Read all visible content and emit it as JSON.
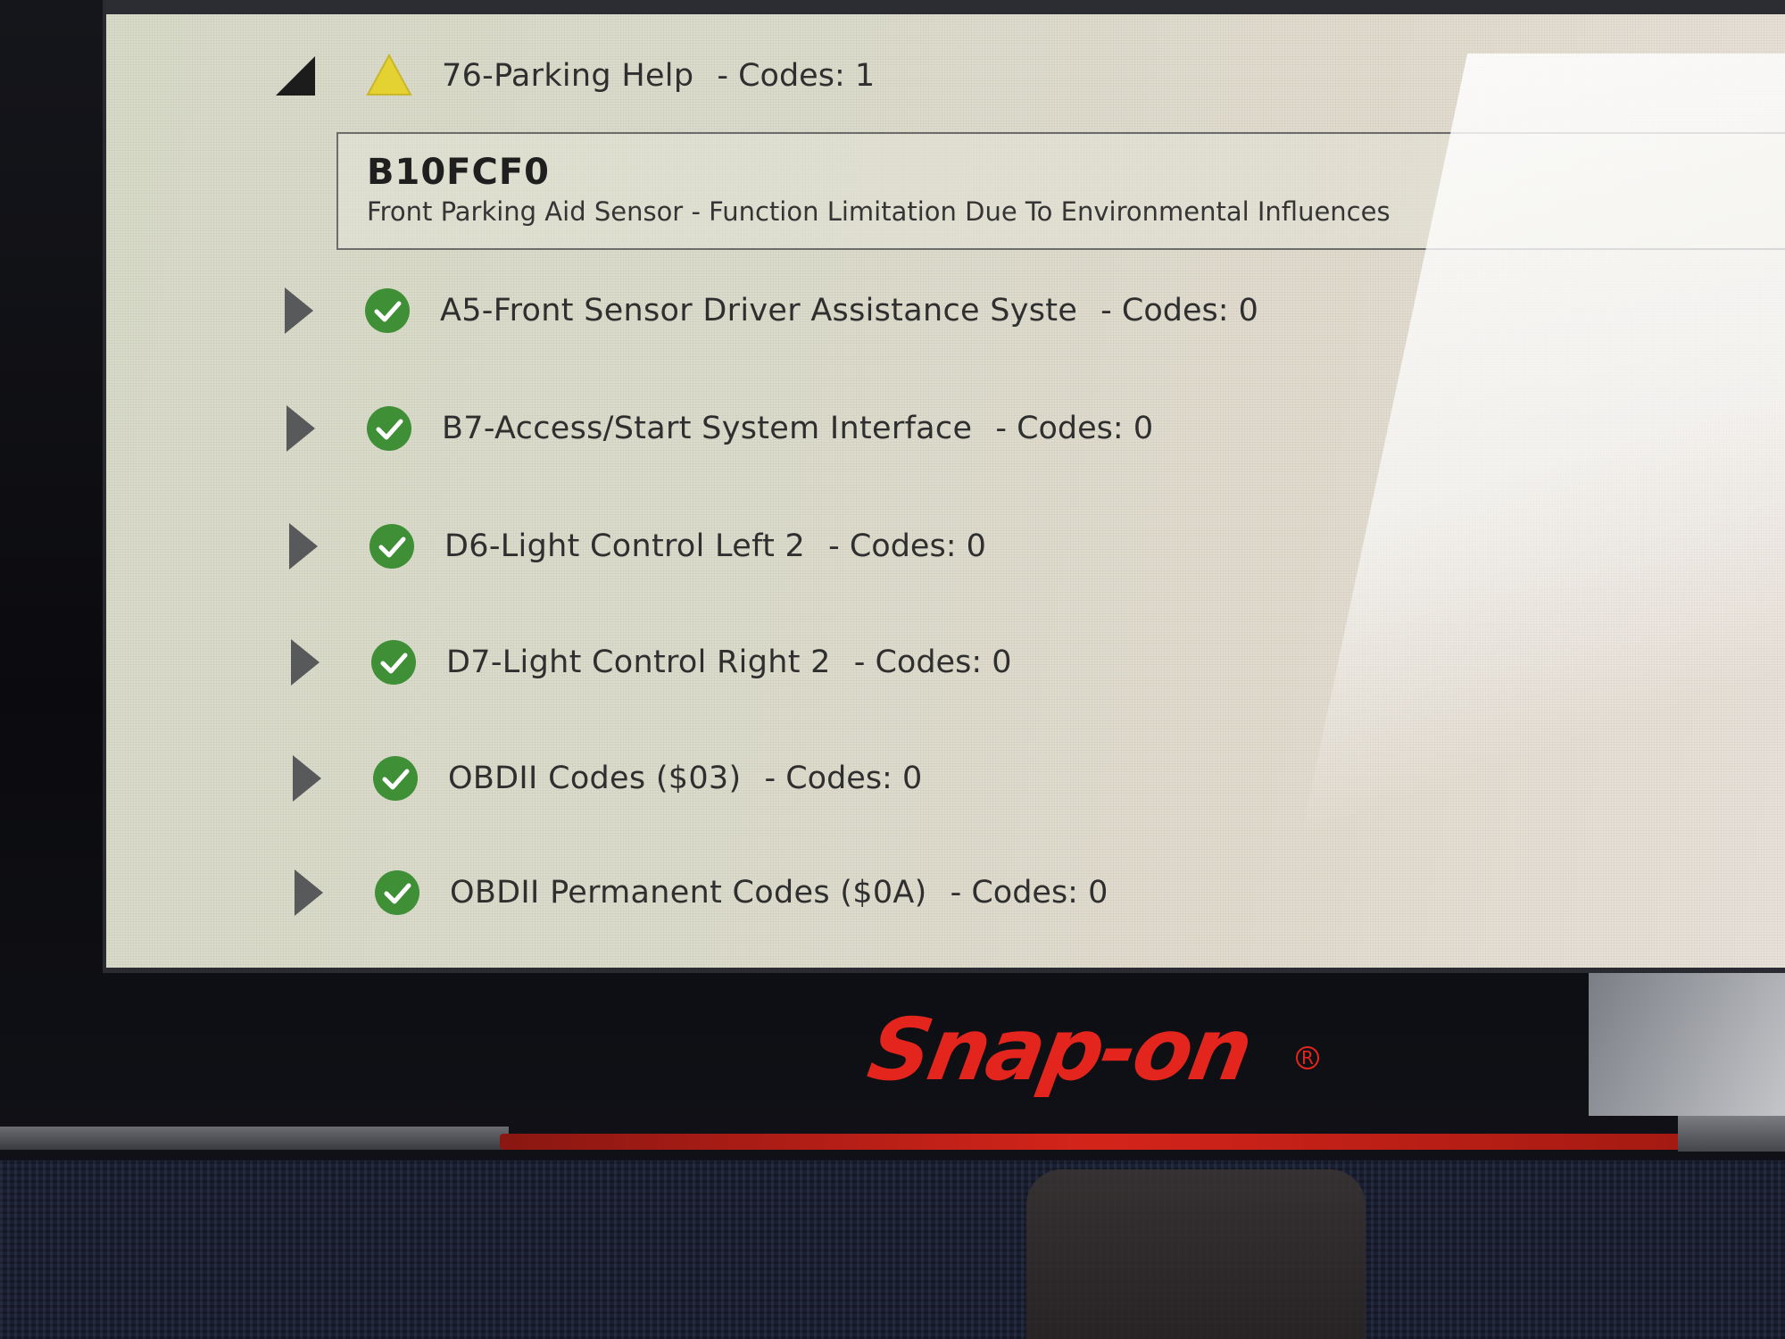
{
  "brand": {
    "name": "Snap-on",
    "reg": "R"
  },
  "colors": {
    "brand_red": "#e3251d",
    "ok_green": "#3f8f36",
    "warn_yellow": "#e4d233"
  },
  "expanded_module": {
    "label": "76-Parking Help",
    "codes": "- Codes: 1",
    "status_icon": "warning-icon",
    "code": {
      "id": "B10FCF0",
      "description": "Front Parking Aid Sensor - Function Limitation Due To Environmental Influences"
    }
  },
  "modules": [
    {
      "label": "A5-Front Sensor Driver Assistance Syste",
      "codes": "- Codes: 0",
      "status_icon": "check-icon"
    },
    {
      "label": "B7-Access/Start System Interface",
      "codes": "- Codes: 0",
      "status_icon": "check-icon"
    },
    {
      "label": "D6-Light Control Left 2",
      "codes": "- Codes: 0",
      "status_icon": "check-icon"
    },
    {
      "label": "D7-Light Control Right 2",
      "codes": "- Codes: 0",
      "status_icon": "check-icon"
    },
    {
      "label": "OBDII Codes ($03)",
      "codes": "- Codes: 0",
      "status_icon": "check-icon"
    },
    {
      "label": "OBDII Permanent Codes ($0A)",
      "codes": "- Codes: 0",
      "status_icon": "check-icon"
    }
  ]
}
